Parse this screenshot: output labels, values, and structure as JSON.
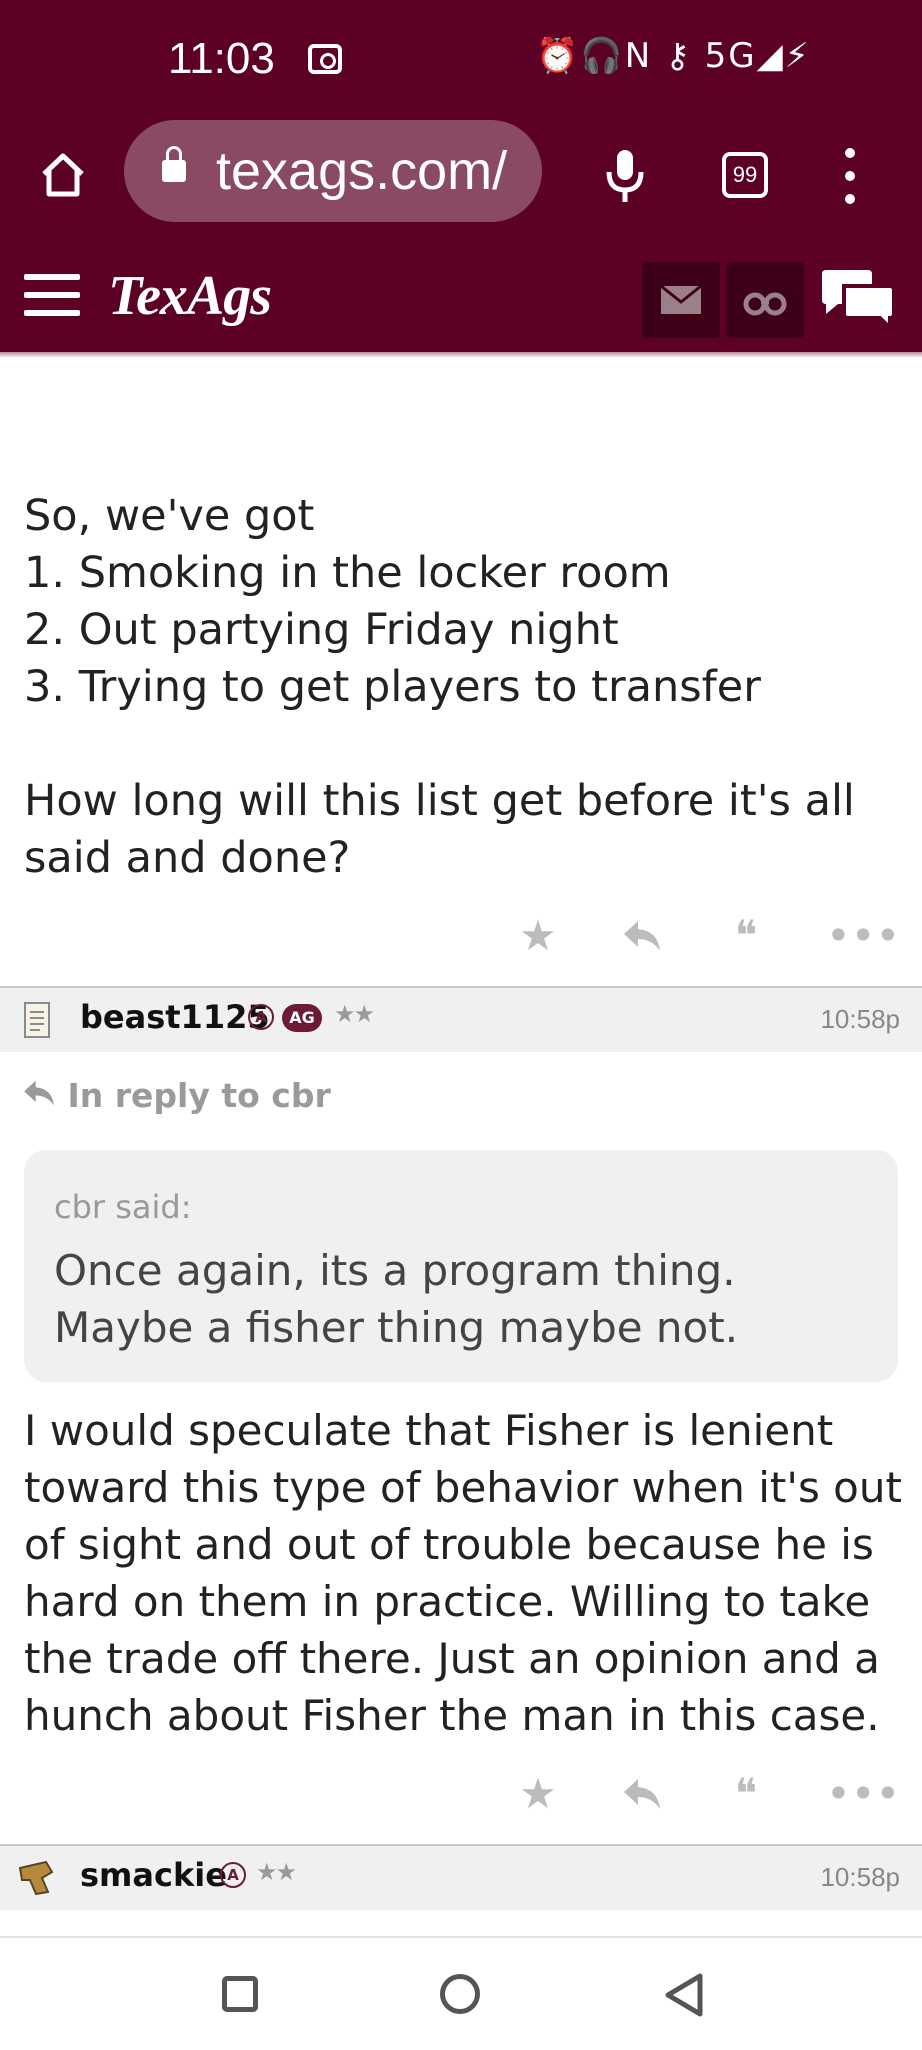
{
  "status_bar": {
    "time": "11:03",
    "icons": [
      "screen-record-icon",
      "alarm-icon",
      "headphones-icon",
      "nfc-icon",
      "key-icon",
      "5g-icon",
      "signal-icon",
      "charging-icon"
    ],
    "network": "5G"
  },
  "browser": {
    "url": "texags.com/",
    "tab_count": "99"
  },
  "site_nav": {
    "logo": "TexAgs"
  },
  "post1": {
    "lines": [
      "So, we've got",
      "1. Smoking in the locker room",
      "2. Out partying Friday night",
      "3. Trying to get players to transfer",
      "",
      "How long will this list get before it's all",
      "said and done?"
    ]
  },
  "post2": {
    "username": "beast1125",
    "badge_a": "A",
    "badge_ag": "AG",
    "stars": "★★",
    "time": "10:58p",
    "reply_to": "In reply to cbr",
    "quote_author": "cbr said:",
    "quote_lines": [
      "Once again, its a program thing.",
      "Maybe a fisher thing maybe not."
    ],
    "body_lines": [
      "I would speculate that Fisher is lenient",
      "toward this type of behavior when it's out",
      "of sight and out of trouble because he is",
      "hard on them in practice. Willing to take",
      "the trade off there. Just an opinion and a",
      "hunch about Fisher the man in this case."
    ]
  },
  "post3": {
    "username": "smackie",
    "badge_a": "A",
    "stars": "★★",
    "time": "10:58p"
  },
  "colors": {
    "brand": "#5c0025",
    "brand_dark": "#3e0018",
    "badge": "#6d1a36"
  }
}
